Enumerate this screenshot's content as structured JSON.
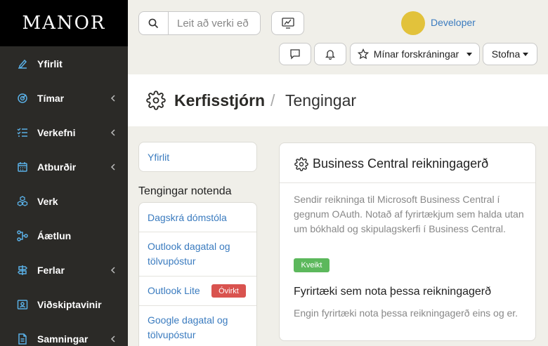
{
  "app": {
    "logo": "MANOR"
  },
  "sidebar": {
    "items": [
      {
        "label": "Yfirlit",
        "icon": "chart-pen-icon"
      },
      {
        "label": "Tímar",
        "icon": "target-clock-icon"
      },
      {
        "label": "Verkefni",
        "icon": "checklist-icon"
      },
      {
        "label": "Atburðir",
        "icon": "calendar-icon"
      },
      {
        "label": "Verk",
        "icon": "cubes-icon"
      },
      {
        "label": "Áætlun",
        "icon": "flow-icon"
      },
      {
        "label": "Ferlar",
        "icon": "signpost-icon"
      },
      {
        "label": "Viðskiptavinir",
        "icon": "contact-card-icon"
      },
      {
        "label": "Samningar",
        "icon": "document-icon"
      }
    ]
  },
  "topbar": {
    "search_placeholder": "Leit að verki eð",
    "user_name": "Developer",
    "bookmarks_label": "Mínar forskráningar",
    "create_label": "Stofna"
  },
  "header": {
    "title": "Kerfisstjórn",
    "separator": "/",
    "subtitle": "Tengingar"
  },
  "left": {
    "overview_link": "Yfirlit",
    "section_title": "Tengingar notenda",
    "connections": [
      {
        "label": "Dagskrá dómstóla"
      },
      {
        "label": "Outlook dagatal og tölvupóstur"
      },
      {
        "label": "Outlook Lite",
        "badge": "Óvirkt"
      },
      {
        "label": "Google dagatal og tölvupóstur"
      }
    ]
  },
  "card": {
    "title": "Business Central reikningagerð",
    "description": "Sendir reikninga til Microsoft Business Central í gegnum OAuth. Notað af fyrirtækjum sem halda utan um bókhald og skipulagskerfi í Business Central.",
    "status_badge": "Kveikt",
    "companies_heading": "Fyrirtæki sem nota þessa reikningagerð",
    "companies_empty": "Engin fyrirtæki nota þessa reikningagerð eins og er."
  },
  "colors": {
    "sidebar_bg": "#2b2a27",
    "link": "#3a7bbf",
    "avatar": "#e2c23b",
    "badge_on": "#5cb85c",
    "badge_off": "#d9534f"
  }
}
